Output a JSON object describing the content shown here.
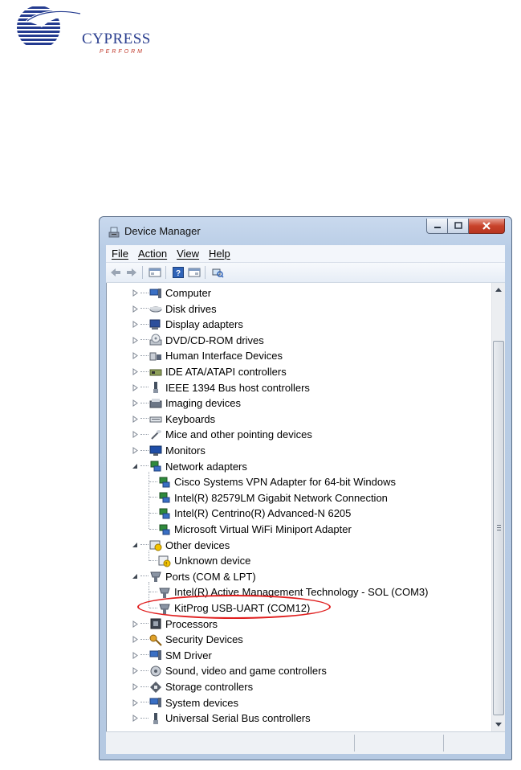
{
  "logo": {
    "word": "CYPRESS",
    "tagline": "PERFORM"
  },
  "window": {
    "title": "Device Manager",
    "menu": [
      "File",
      "Action",
      "View",
      "Help"
    ]
  },
  "tree": {
    "categories": [
      {
        "label": "Computer",
        "icon": "computer-icon"
      },
      {
        "label": "Disk drives",
        "icon": "disk-drive-icon"
      },
      {
        "label": "Display adapters",
        "icon": "display-adapter-icon"
      },
      {
        "label": "DVD/CD-ROM drives",
        "icon": "dvd-drive-icon"
      },
      {
        "label": "Human Interface Devices",
        "icon": "hid-icon"
      },
      {
        "label": "IDE ATA/ATAPI controllers",
        "icon": "ide-controller-icon"
      },
      {
        "label": "IEEE 1394 Bus host controllers",
        "icon": "ieee1394-icon"
      },
      {
        "label": "Imaging devices",
        "icon": "imaging-icon"
      },
      {
        "label": "Keyboards",
        "icon": "keyboard-icon"
      },
      {
        "label": "Mice and other pointing devices",
        "icon": "mouse-icon"
      },
      {
        "label": "Monitors",
        "icon": "monitor-icon"
      },
      {
        "label": "Network adapters",
        "icon": "network-icon",
        "expanded": true,
        "children": [
          "Cisco Systems VPN Adapter for 64-bit Windows",
          "Intel(R) 82579LM Gigabit Network Connection",
          "Intel(R) Centrino(R) Advanced-N 6205",
          "Microsoft Virtual WiFi Miniport Adapter"
        ]
      },
      {
        "label": "Other devices",
        "icon": "other-devices-icon",
        "expanded": true,
        "children": [
          "Unknown device"
        ]
      },
      {
        "label": "Ports (COM & LPT)",
        "icon": "port-icon",
        "expanded": true,
        "children": [
          "Intel(R) Active Management Technology - SOL (COM3)",
          "KitProg USB-UART (COM12)"
        ]
      },
      {
        "label": "Processors",
        "icon": "processor-icon"
      },
      {
        "label": "Security Devices",
        "icon": "security-icon"
      },
      {
        "label": "SM Driver",
        "icon": "sm-driver-icon"
      },
      {
        "label": "Sound, video and game controllers",
        "icon": "sound-icon"
      },
      {
        "label": "Storage controllers",
        "icon": "storage-icon"
      },
      {
        "label": "System devices",
        "icon": "system-devices-icon"
      },
      {
        "label": "Universal Serial Bus controllers",
        "icon": "usb-icon"
      }
    ]
  },
  "colors": {
    "highlight": "#e01e1e",
    "brand": "#2b3f8f"
  }
}
